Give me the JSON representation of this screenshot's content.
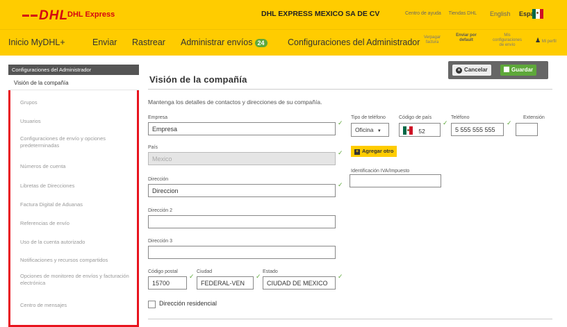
{
  "header": {
    "logo": "DHL",
    "brand": "DHL Express",
    "company": "DHL EXPRESS MEXICO SA DE CV",
    "links": [
      "Centro de ayuda",
      "Tiendas DHL"
    ],
    "lang_en": "English",
    "lang_es": "Español"
  },
  "nav": {
    "home": "Inicio MyDHL+",
    "send": "Enviar",
    "track": "Rastrear",
    "manage": "Administrar envíos",
    "manage_count": "24",
    "admin": "Configuraciones del Administrador",
    "view_invoice": "Verpagar factura",
    "ship_default": "Enviar por default",
    "ship_settings": "Mis configuraciones de envío",
    "profile": "Mi perfil"
  },
  "sidebar": {
    "header": "Configuraciones del Administrador",
    "selected": "Visión de la compañía",
    "items": [
      "Grupos",
      "Usuarios",
      "Configuraciones de envío y opciones predeterminadas",
      "Números de cuenta",
      "Libretas de Direcciones",
      "Factura Digital de Aduanas",
      "Referencias de envío",
      "Uso de la cuenta autorizado",
      "Notificaciones y recursos compartidos",
      "Opciones de monitoreo de envíos y facturación electrónica",
      "Centro de mensajes"
    ]
  },
  "main": {
    "title": "Visión de la compañía",
    "cancel": "Cancelar",
    "save": "Guardar",
    "description": "Mantenga los detalles de contactos y direcciones de su compañía.",
    "company_label": "Empresa",
    "company_value": "Empresa",
    "country_label": "País",
    "country_value": "Mexico",
    "address_label": "Dirección",
    "address_value": "Direccion",
    "address2_label": "Dirección 2",
    "address3_label": "Dirección 3",
    "postal_label": "Código postal",
    "postal_value": "15700",
    "city_label": "Ciudad",
    "city_value": "FEDERAL-VEN",
    "state_label": "Estado",
    "state_value": "CIUDAD DE MEXICO",
    "residential_label": "Dirección residencial",
    "phone_type_label": "Tipo de teléfono",
    "phone_type_value": "Oficina",
    "country_code_label": "Código de país",
    "country_code_value": "52",
    "phone_label": "Teléfono",
    "phone_value": "5 555 555 555",
    "extension_label": "Extensión",
    "add_other": "Agregar otro",
    "tax_id_label": "Identificación IVA/Impuesto"
  },
  "colors": {
    "dhl_yellow": "#ffcc00",
    "dhl_red": "#d40511",
    "success_green": "#5ea83a"
  }
}
